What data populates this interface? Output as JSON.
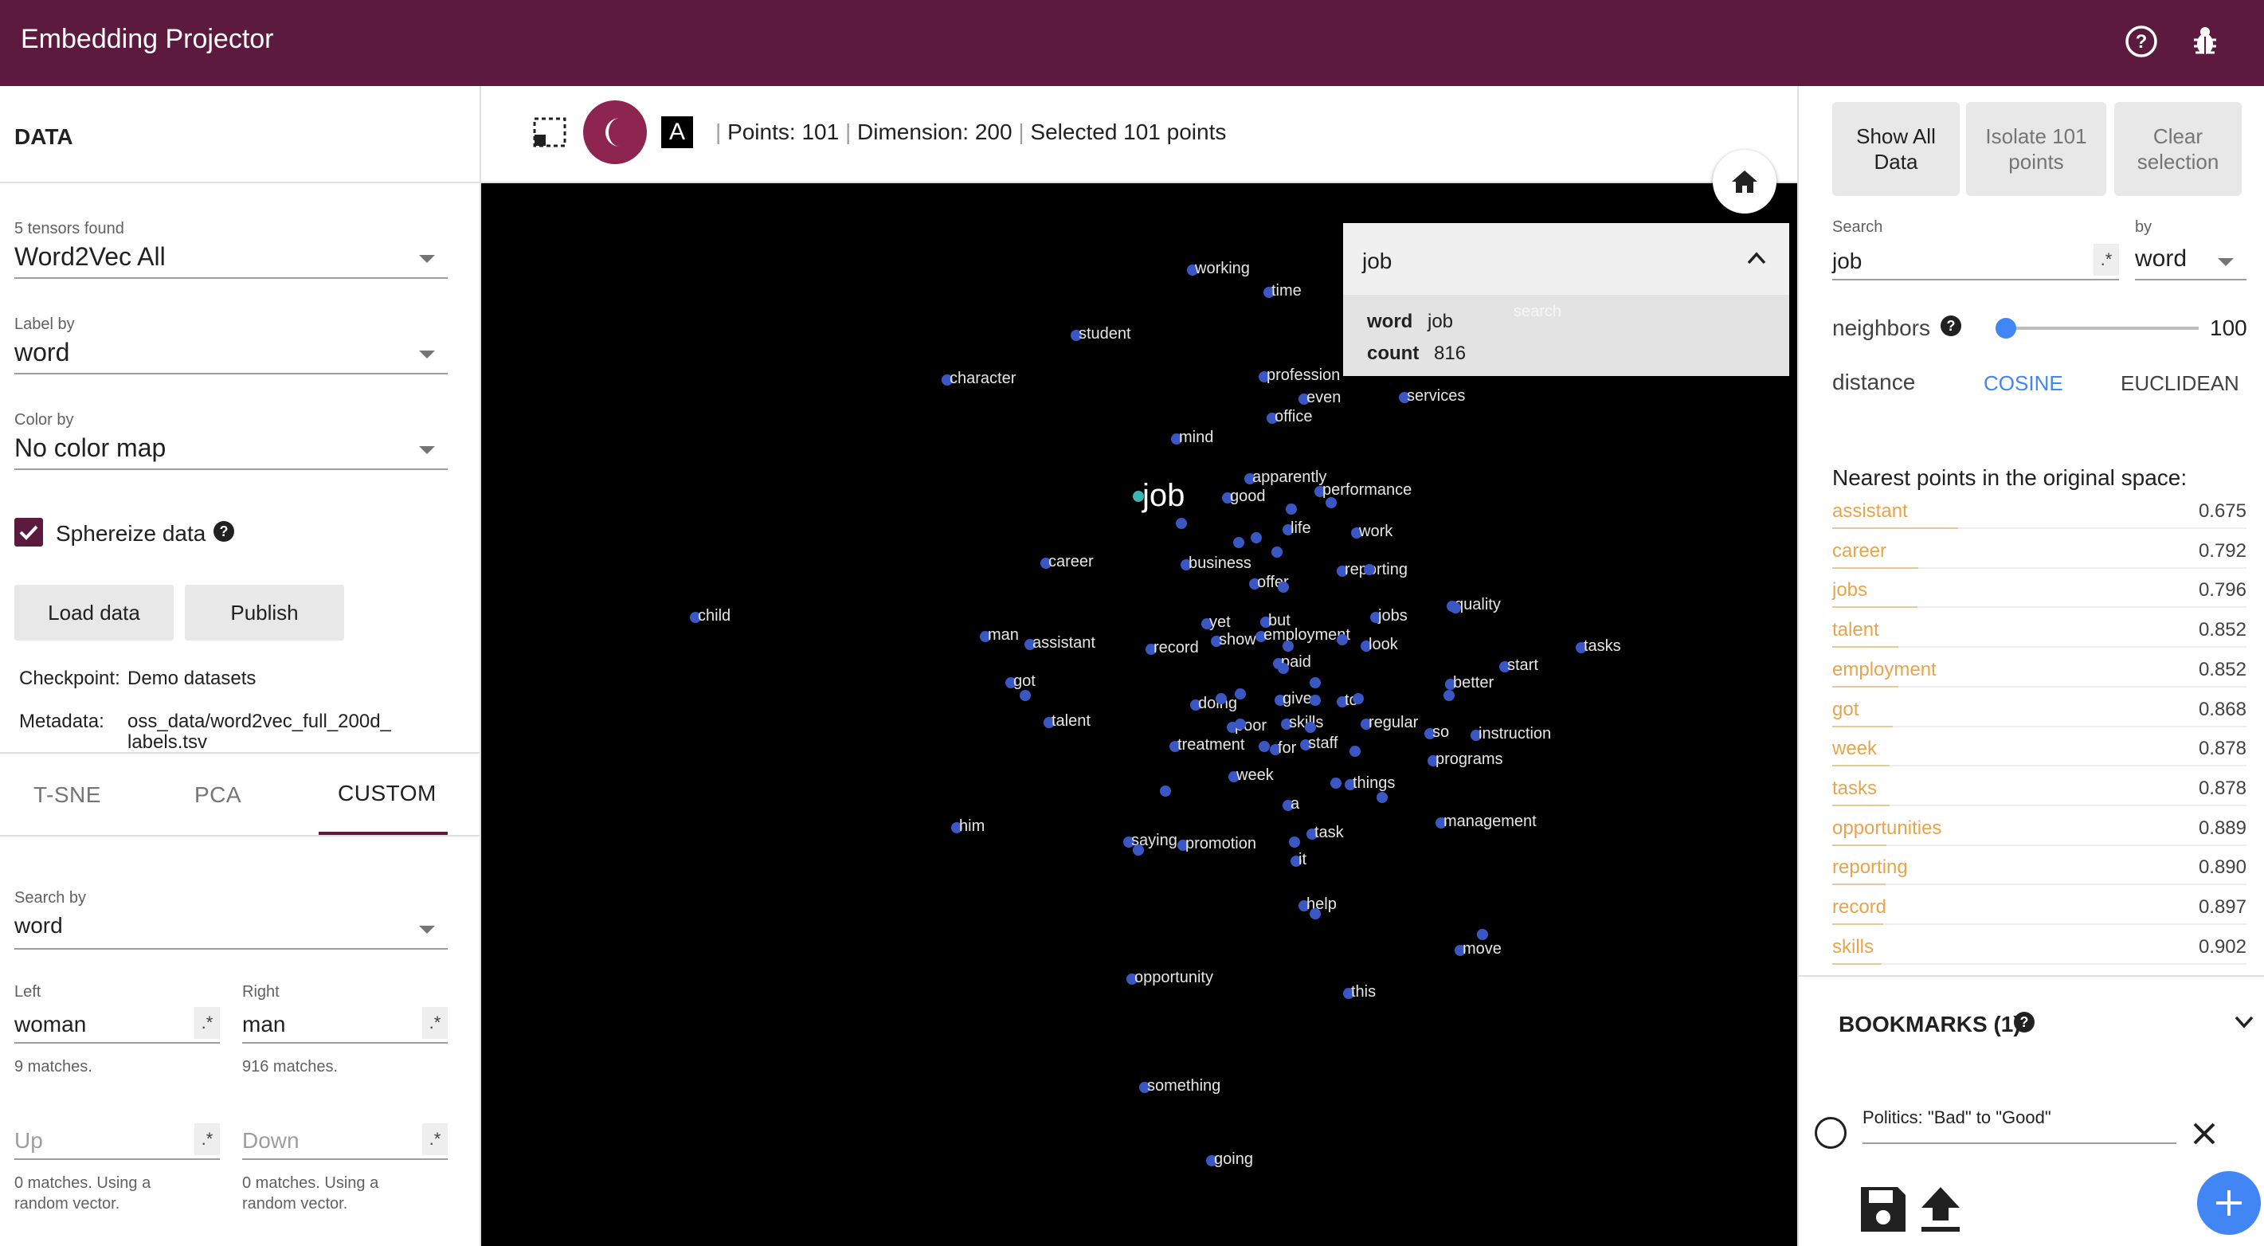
{
  "header": {
    "title": "Embedding Projector",
    "help_icon": "help-circle-icon",
    "bug_icon": "bug-icon",
    "bg_color": "#5c1a3e"
  },
  "data_panel": {
    "title": "DATA",
    "tensors_label": "5 tensors found",
    "tensor_value": "Word2Vec All",
    "label_by_label": "Label by",
    "label_by_value": "word",
    "color_by_label": "Color by",
    "color_by_value": "No color map",
    "sphereize_label": "Sphereize data",
    "sphereize_checked": true,
    "load_button": "Load data",
    "publish_button": "Publish",
    "checkpoint_label": "Checkpoint:",
    "checkpoint_value": "Demo datasets",
    "metadata_label": "Metadata:",
    "metadata_value_1": "oss_data/word2vec_full_200d_",
    "metadata_value_2": "labels.tsv"
  },
  "projection_tabs": {
    "tsne": "T-SNE",
    "pca": "PCA",
    "custom": "CUSTOM",
    "active": "CUSTOM"
  },
  "custom_panel": {
    "search_by_label": "Search by",
    "search_by_value": "word",
    "left_label": "Left",
    "left_value": "woman",
    "left_matches": "9 matches.",
    "right_label": "Right",
    "right_value": "man",
    "right_matches": "916 matches.",
    "up_placeholder": "Up",
    "up_note_1": "0 matches. Using a",
    "up_note_2": "random vector.",
    "down_placeholder": "Down",
    "down_note_1": "0 matches. Using a",
    "down_note_2": "random vector.",
    "regex_symbol": ".*"
  },
  "toolbar": {
    "select_icon": "selection-rectangle-icon",
    "night_icon": "night-mode-icon",
    "label_icon": "label-toggle-icon",
    "label_icon_text": "A",
    "points": "Points: 101",
    "dimension": "Dimension: 200",
    "selected": "Selected 101 points",
    "home_icon": "home-icon"
  },
  "info_card": {
    "title": "job",
    "word_key": "word",
    "word_value": "job",
    "count_key": "count",
    "count_value": "816",
    "faint_text": "search"
  },
  "focus_point": "job",
  "points": [
    {
      "label": "working"
    },
    {
      "label": "time"
    },
    {
      "label": "student"
    },
    {
      "label": "character"
    },
    {
      "label": "profession"
    },
    {
      "label": "even"
    },
    {
      "label": "services"
    },
    {
      "label": "office"
    },
    {
      "label": "mind"
    },
    {
      "label": "apparently"
    },
    {
      "label": "good"
    },
    {
      "label": "performance"
    },
    {
      "label": "life"
    },
    {
      "label": "work"
    },
    {
      "label": "career"
    },
    {
      "label": "business"
    },
    {
      "label": "reporting"
    },
    {
      "label": "offer"
    },
    {
      "label": "child"
    },
    {
      "label": "quality"
    },
    {
      "label": "yet"
    },
    {
      "label": "but"
    },
    {
      "label": "jobs"
    },
    {
      "label": "man"
    },
    {
      "label": "assistant"
    },
    {
      "label": "show"
    },
    {
      "label": "employment"
    },
    {
      "label": "look"
    },
    {
      "label": "tasks"
    },
    {
      "label": "record"
    },
    {
      "label": "paid"
    },
    {
      "label": "start"
    },
    {
      "label": "got"
    },
    {
      "label": "better"
    },
    {
      "label": "give"
    },
    {
      "label": "doing"
    },
    {
      "label": "to"
    },
    {
      "label": "talent"
    },
    {
      "label": "poor"
    },
    {
      "label": "skills"
    },
    {
      "label": "regular"
    },
    {
      "label": "so"
    },
    {
      "label": "instruction"
    },
    {
      "label": "treatment"
    },
    {
      "label": "for"
    },
    {
      "label": "staff"
    },
    {
      "label": "programs"
    },
    {
      "label": "week"
    },
    {
      "label": "things"
    },
    {
      "label": "a"
    },
    {
      "label": "him"
    },
    {
      "label": "management"
    },
    {
      "label": "task"
    },
    {
      "label": "saying"
    },
    {
      "label": "promotion"
    },
    {
      "label": "it"
    },
    {
      "label": "help"
    },
    {
      "label": "move"
    },
    {
      "label": "opportunity"
    },
    {
      "label": "this"
    },
    {
      "label": "something"
    },
    {
      "label": "going"
    }
  ],
  "right_panel": {
    "show_all": "Show All Data",
    "isolate": "Isolate 101 points",
    "clear": "Clear selection",
    "search_label": "Search",
    "search_value": "job",
    "by_label": "by",
    "by_value": "word",
    "neighbors_label": "neighbors",
    "neighbors_value": "100",
    "neighbors_fraction": 0.03,
    "distance_label": "distance",
    "cosine": "COSINE",
    "euclidean": "EUCLIDEAN",
    "nearest_title": "Nearest points in the original space:",
    "nearest": [
      {
        "word": "assistant",
        "value": "0.675"
      },
      {
        "word": "career",
        "value": "0.792"
      },
      {
        "word": "jobs",
        "value": "0.796"
      },
      {
        "word": "talent",
        "value": "0.852"
      },
      {
        "word": "employment",
        "value": "0.852"
      },
      {
        "word": "got",
        "value": "0.868"
      },
      {
        "word": "week",
        "value": "0.878"
      },
      {
        "word": "tasks",
        "value": "0.878"
      },
      {
        "word": "opportunities",
        "value": "0.889"
      },
      {
        "word": "reporting",
        "value": "0.890"
      },
      {
        "word": "record",
        "value": "0.897"
      },
      {
        "word": "skills",
        "value": "0.902"
      }
    ],
    "bookmarks_title": "BOOKMARKS (1)",
    "bookmark_name": "Politics: \"Bad\" to \"Good\"",
    "accent_color": "#4285f4",
    "nn_color": "#e8a44a"
  }
}
